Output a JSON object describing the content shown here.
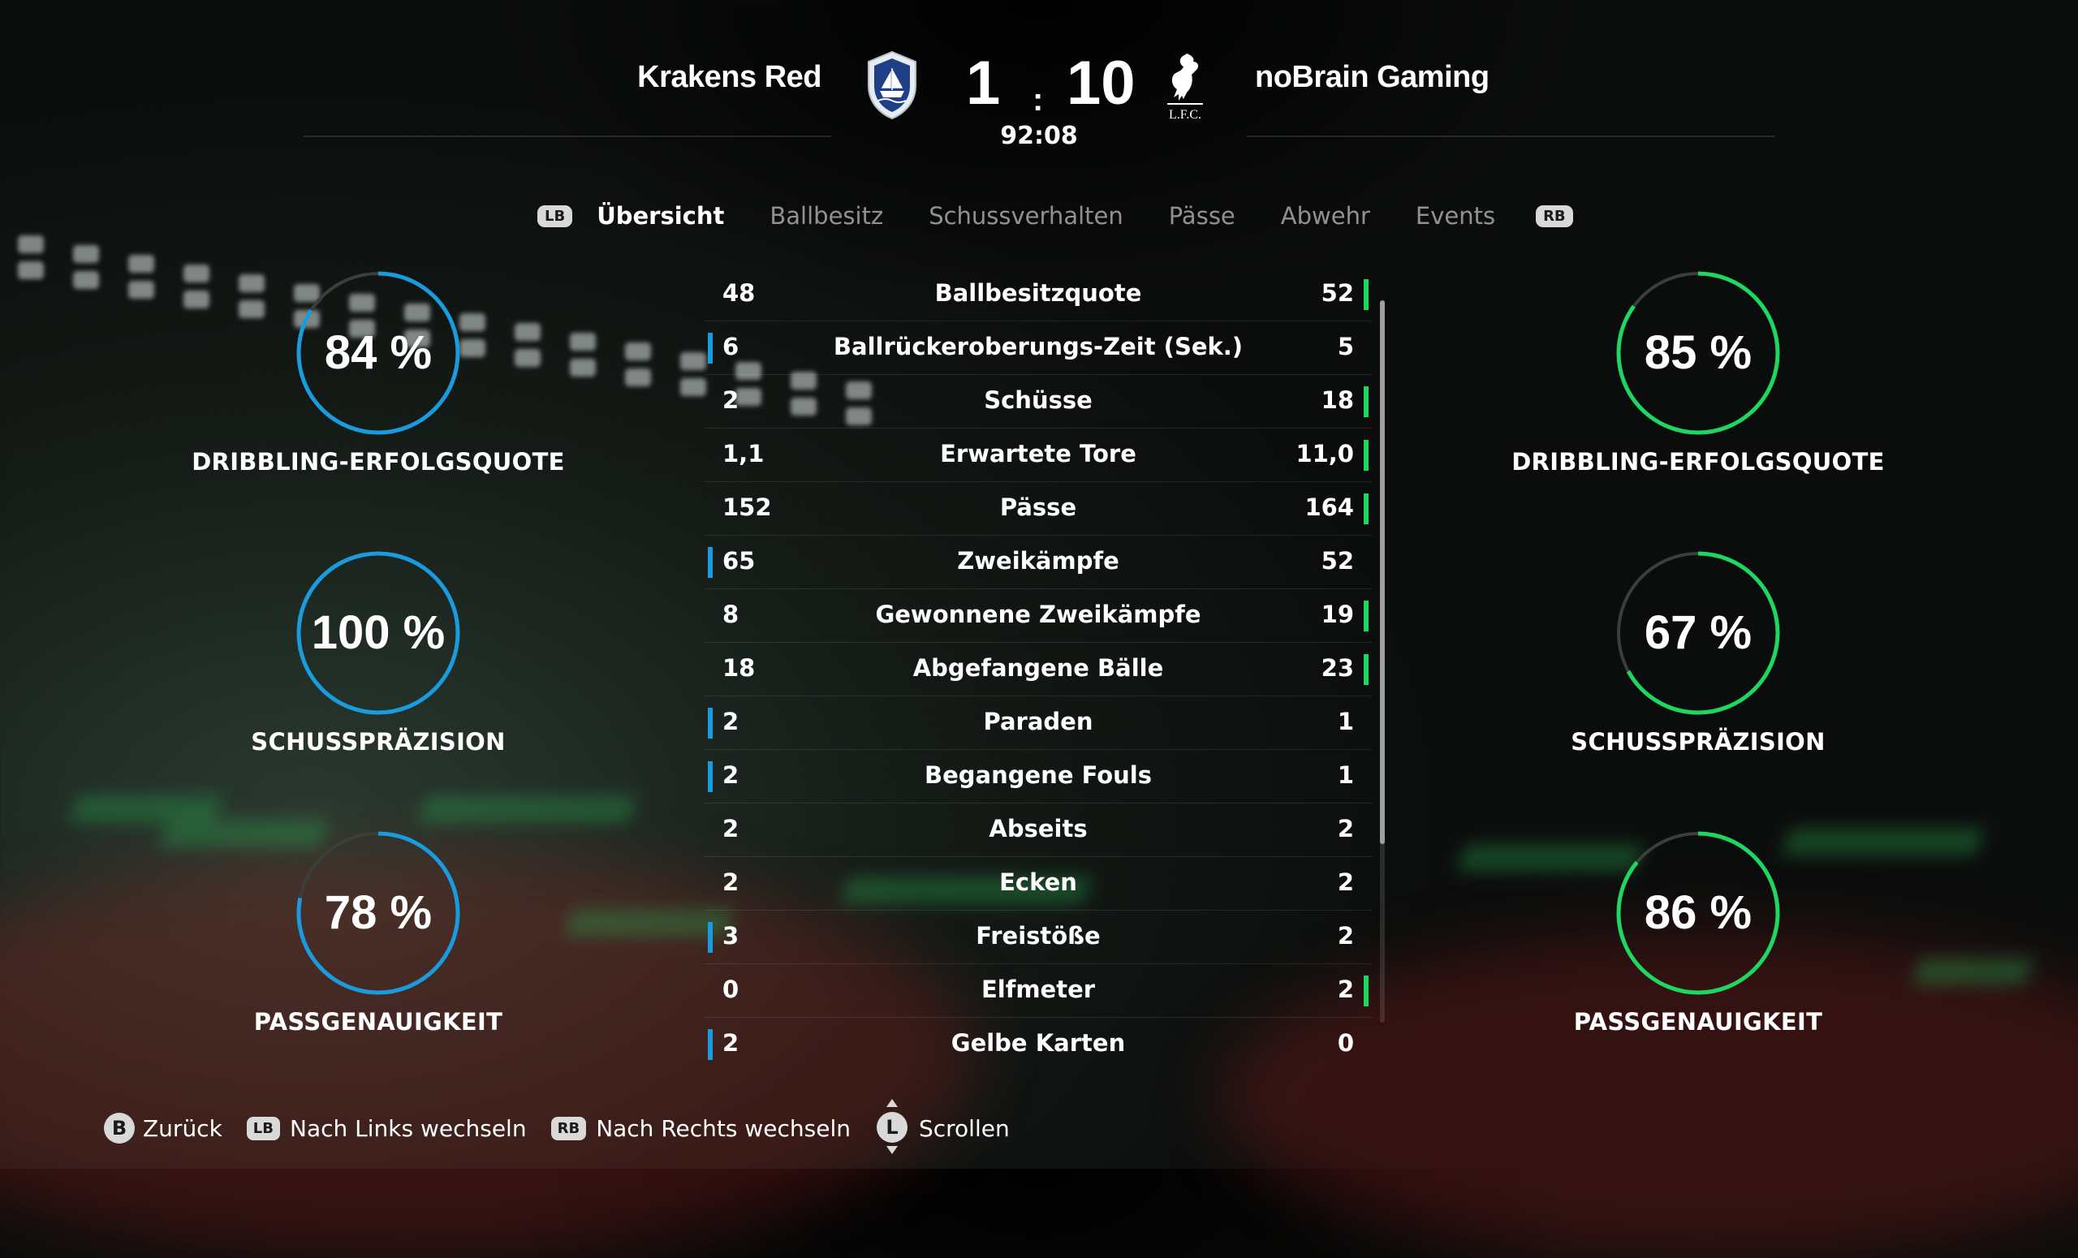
{
  "match": {
    "home_team": "Krakens Red",
    "away_team": "noBrain Gaming",
    "home_score": "1",
    "separator": ":",
    "away_score": "10",
    "clock": "92:08",
    "away_crest_text": "L.F.C."
  },
  "tabs": {
    "left_button": "LB",
    "right_button": "RB",
    "items": [
      "Übersicht",
      "Ballbesitz",
      "Schussverhalten",
      "Pässe",
      "Abwehr",
      "Events"
    ],
    "active": "Übersicht"
  },
  "home_circles": [
    {
      "value": 84,
      "text": "84 %",
      "label": "DRIBBLING-ERFOLGSQUOTE"
    },
    {
      "value": 100,
      "text": "100 %",
      "label": "SCHUSSPRÄZISION"
    },
    {
      "value": 78,
      "text": "78 %",
      "label": "PASSGENAUIGKEIT"
    }
  ],
  "away_circles": [
    {
      "value": 85,
      "text": "85 %",
      "label": "DRIBBLING-ERFOLGSQUOTE"
    },
    {
      "value": 67,
      "text": "67 %",
      "label": "SCHUSSPRÄZISION"
    },
    {
      "value": 86,
      "text": "86 %",
      "label": "PASSGENAUIGKEIT"
    }
  ],
  "stats": [
    {
      "name": "Ballbesitzquote",
      "home": "48",
      "away": "52",
      "leader": "away"
    },
    {
      "name": "Ballrückeroberungs-Zeit (Sek.)",
      "home": "6",
      "away": "5",
      "leader": "home"
    },
    {
      "name": "Schüsse",
      "home": "2",
      "away": "18",
      "leader": "away"
    },
    {
      "name": "Erwartete Tore",
      "home": "1,1",
      "away": "11,0",
      "leader": "away"
    },
    {
      "name": "Pässe",
      "home": "152",
      "away": "164",
      "leader": "away"
    },
    {
      "name": "Zweikämpfe",
      "home": "65",
      "away": "52",
      "leader": "home"
    },
    {
      "name": "Gewonnene Zweikämpfe",
      "home": "8",
      "away": "19",
      "leader": "away"
    },
    {
      "name": "Abgefangene Bälle",
      "home": "18",
      "away": "23",
      "leader": "away"
    },
    {
      "name": "Paraden",
      "home": "2",
      "away": "1",
      "leader": "home"
    },
    {
      "name": "Begangene Fouls",
      "home": "2",
      "away": "1",
      "leader": "home"
    },
    {
      "name": "Abseits",
      "home": "2",
      "away": "2",
      "leader": "none"
    },
    {
      "name": "Ecken",
      "home": "2",
      "away": "2",
      "leader": "none"
    },
    {
      "name": "Freistöße",
      "home": "3",
      "away": "2",
      "leader": "home"
    },
    {
      "name": "Elfmeter",
      "home": "0",
      "away": "2",
      "leader": "away"
    },
    {
      "name": "Gelbe Karten",
      "home": "2",
      "away": "0",
      "leader": "home"
    }
  ],
  "footer": [
    {
      "button": "B",
      "label": "Zurück",
      "kind": "circle"
    },
    {
      "button": "LB",
      "label": "Nach Links wechseln",
      "kind": "pill"
    },
    {
      "button": "RB",
      "label": "Nach Rechts wechseln",
      "kind": "pill"
    },
    {
      "button": "L",
      "label": "Scrollen",
      "kind": "stick"
    }
  ],
  "colors": {
    "home": "#1a9bde",
    "away": "#1ed761",
    "track": "#3a3f3c"
  }
}
